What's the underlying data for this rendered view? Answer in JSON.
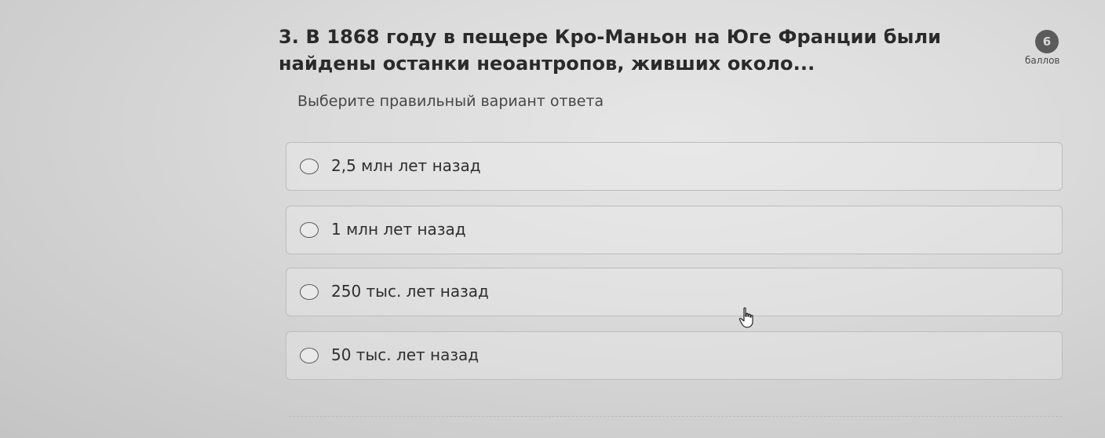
{
  "question": {
    "title": "3. В 1868 году в пещере Кро-Маньон на Юге Франции были найдены останки неоантропов, живших около...",
    "points_value": "6",
    "points_label": "баллов",
    "instruction": "Выберите правильный вариант ответа"
  },
  "options": [
    {
      "label": "2,5 млн лет назад",
      "selected": false
    },
    {
      "label": "1 млн лет назад",
      "selected": false
    },
    {
      "label": "250 тыс. лет назад",
      "selected": false
    },
    {
      "label": "50 тыс. лет назад",
      "selected": false
    }
  ],
  "icons": {
    "radio": "radio-button-icon",
    "cursor": "hand-pointer-cursor-icon"
  },
  "colors": {
    "badge_background": "#5b5b5b",
    "text": "#2e2e2e"
  }
}
